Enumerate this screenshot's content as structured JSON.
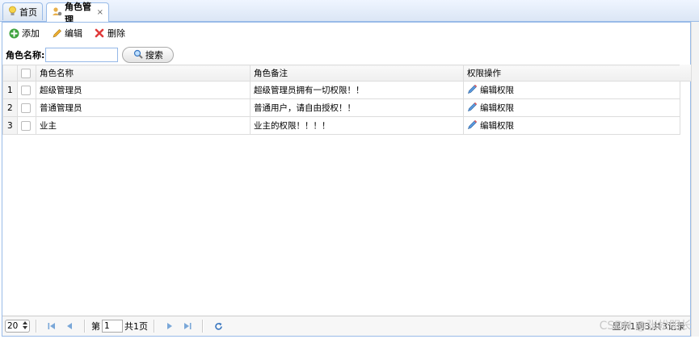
{
  "tabs": [
    {
      "label": "首页",
      "icon": "lightbulb-icon"
    },
    {
      "label": "角色管理",
      "icon": "users-gear-icon",
      "closable": true,
      "close_label": "×"
    }
  ],
  "toolbar": {
    "add_label": "添加",
    "edit_label": "编辑",
    "delete_label": "删除"
  },
  "search": {
    "label": "角色名称:",
    "value": "",
    "placeholder": "",
    "button_label": "搜索"
  },
  "table": {
    "columns": [
      "角色名称",
      "角色备注",
      "权限操作"
    ],
    "rows": [
      {
        "num": "1",
        "name": "超级管理员",
        "remark": "超级管理员拥有一切权限！！",
        "action": "编辑权限"
      },
      {
        "num": "2",
        "name": "普通管理员",
        "remark": "普通用户，请自由授权！！",
        "action": "编辑权限"
      },
      {
        "num": "3",
        "name": "业主",
        "remark": "业主的权限！！！！",
        "action": "编辑权限"
      }
    ]
  },
  "pager": {
    "page_size": "20",
    "page_prefix": "第",
    "page_value": "1",
    "page_suffix": "共1页",
    "info": "显示1到3,共3记录"
  },
  "watermark": "CSDN @张松明长",
  "colors": {
    "accent": "#99bbe8",
    "border": "#dddddd"
  }
}
